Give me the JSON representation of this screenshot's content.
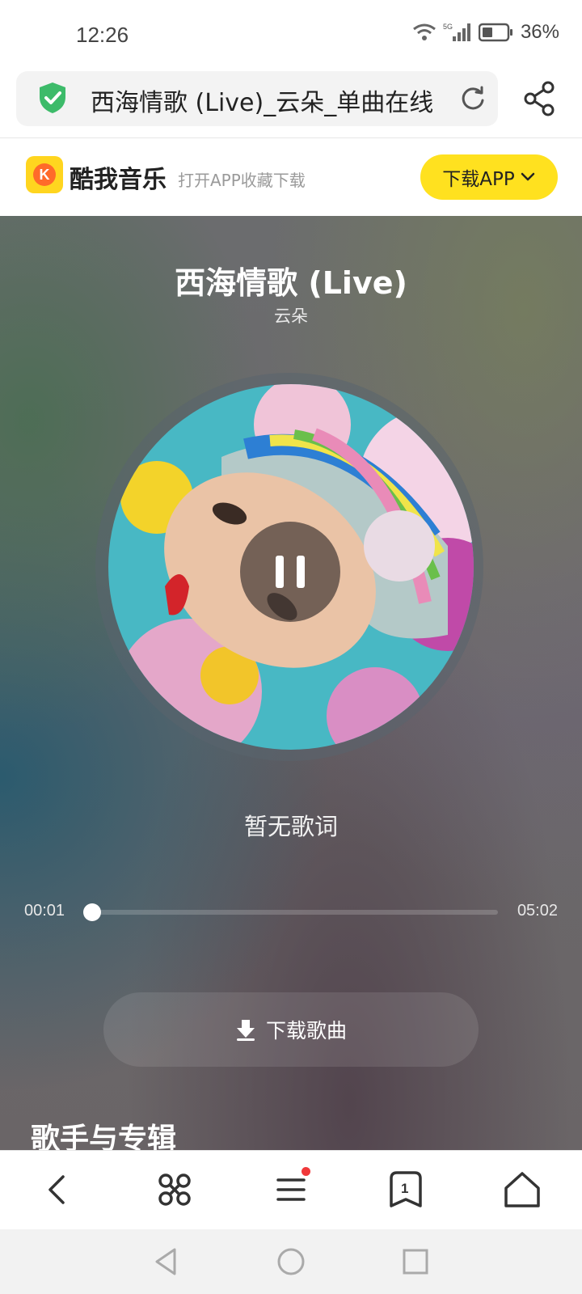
{
  "status": {
    "time": "12:26",
    "battery": "36%",
    "network": "5G"
  },
  "browser": {
    "url_text": "西海情歌 (Live)_云朵_单曲在线"
  },
  "banner": {
    "app_name": "酷我音乐",
    "slogan": "打开APP收藏下载",
    "download_app_label": "下载APP"
  },
  "player": {
    "song_title": "西海情歌 (Live)",
    "artist": "云朵",
    "lyrics": "暂无歌词",
    "current_time": "00:01",
    "total_time": "05:02",
    "progress_fraction": 0.003,
    "download_song_label": "下载歌曲",
    "section_title": "歌手与专辑"
  },
  "colors": {
    "accent_yellow": "#ffe11f",
    "shield_green": "#3dbb6a",
    "notify_red": "#f0383a"
  }
}
